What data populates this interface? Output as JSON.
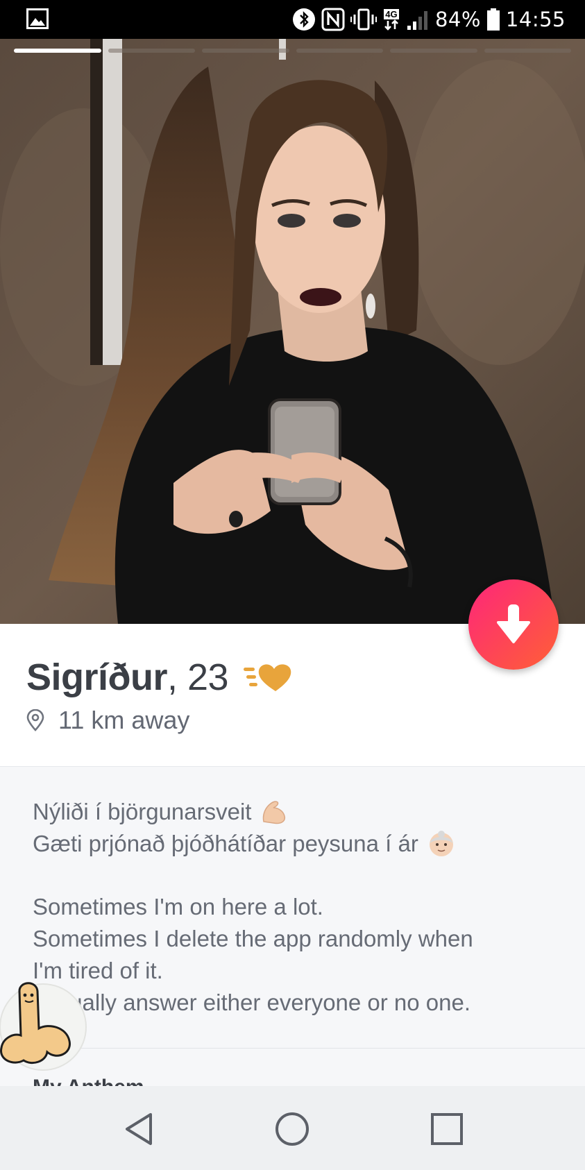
{
  "status_bar": {
    "battery": "84%",
    "time": "14:55",
    "icons": [
      "gallery-icon",
      "bluetooth-icon",
      "nfc-icon",
      "vibrate-icon",
      "4g-data-icon",
      "signal-icon",
      "battery-icon"
    ],
    "network_label": "4G"
  },
  "photo": {
    "count": 6,
    "active_index": 0
  },
  "profile": {
    "name": "Sigríður",
    "age": ", 23",
    "distance": "11 km away",
    "badge_icon": "super-like-heart-icon",
    "accent_color": "#e8a43b"
  },
  "bio": {
    "lines": [
      "Nýliði í björgunarsveit",
      "Gæti prjónað þjóðhátíðar peysuna í ár",
      "Sometimes I'm on here a lot.",
      "Sometimes I delete the app randomly when",
      "I'm tired of it.",
      "I usually answer either everyone or no one."
    ],
    "line_emojis": [
      "flexed-biceps-emoji",
      "old-woman-emoji"
    ]
  },
  "section": {
    "anthem_label": "My Anthem"
  },
  "collapse_button": {
    "icon": "arrow-down-icon",
    "color_start": "#fd267a",
    "color_end": "#ff6036"
  },
  "nav": {
    "back_icon": "back-triangle-icon",
    "home_icon": "home-circle-icon",
    "recents_icon": "recents-square-icon"
  }
}
